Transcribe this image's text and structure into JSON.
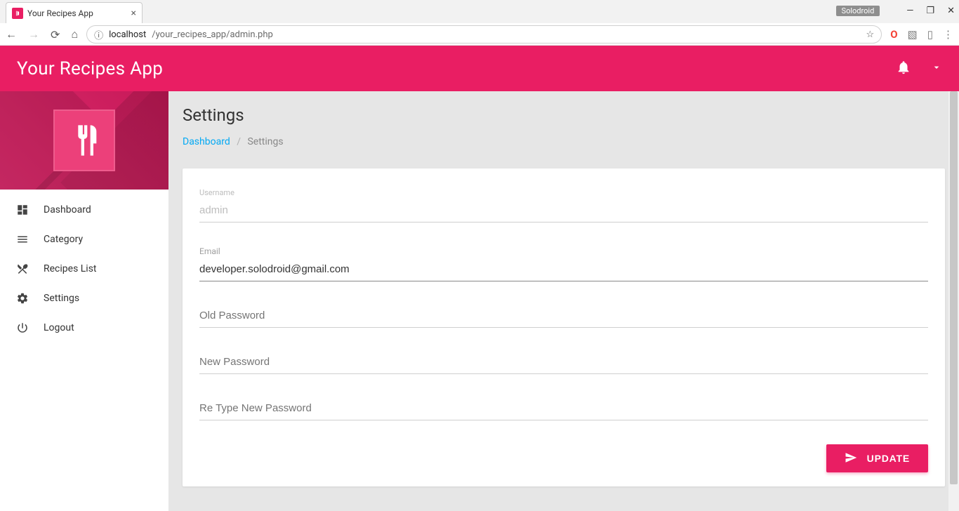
{
  "browser": {
    "tab_title": "Your Recipes App",
    "user_badge": "Solodroid",
    "url_host": "localhost",
    "url_path": "/your_recipes_app/admin.php"
  },
  "topbar": {
    "title": "Your Recipes App"
  },
  "sidebar": {
    "items": [
      {
        "label": "Dashboard",
        "icon": "dashboard-icon"
      },
      {
        "label": "Category",
        "icon": "menu-icon"
      },
      {
        "label": "Recipes List",
        "icon": "utensils-icon"
      },
      {
        "label": "Settings",
        "icon": "gear-icon"
      },
      {
        "label": "Logout",
        "icon": "power-icon"
      }
    ]
  },
  "page": {
    "title": "Settings",
    "breadcrumb_root": "Dashboard",
    "breadcrumb_current": "Settings"
  },
  "form": {
    "username_label": "Username",
    "username_value": "admin",
    "email_label": "Email",
    "email_value": "developer.solodroid@gmail.com",
    "old_password_label": "Old Password",
    "old_password_value": "",
    "new_password_label": "New Password",
    "new_password_value": "",
    "retype_password_label": "Re Type New Password",
    "retype_password_value": "",
    "submit_label": "UPDATE"
  }
}
